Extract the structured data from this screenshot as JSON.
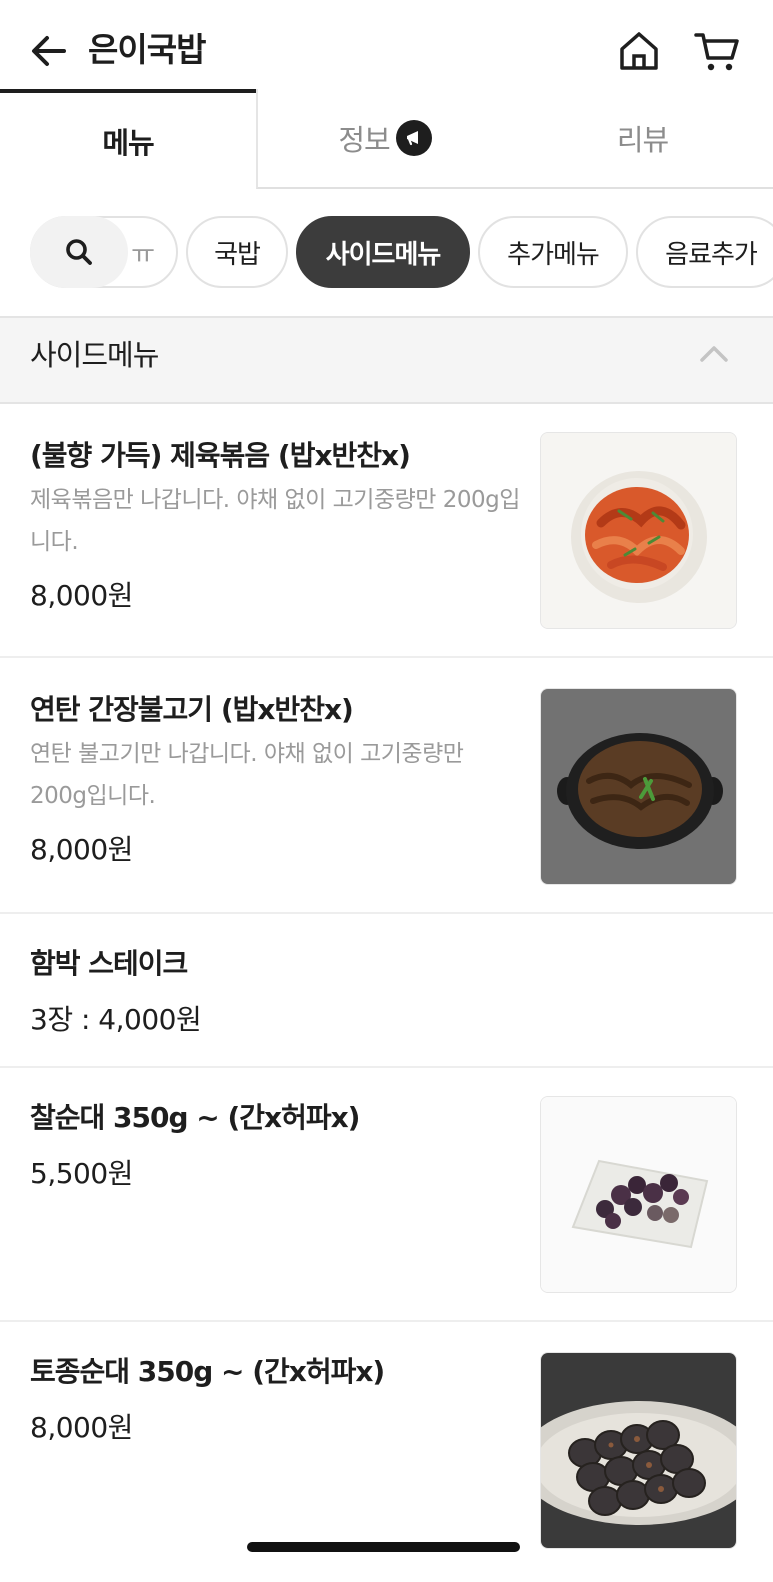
{
  "header": {
    "title": "은이국밥",
    "icons": {
      "back": "arrow-left-icon",
      "home": "home-icon",
      "cart": "cart-icon"
    }
  },
  "tabs": [
    {
      "label": "메뉴",
      "active": true
    },
    {
      "label": "정보",
      "active": false,
      "badge_icon": "megaphone-icon"
    },
    {
      "label": "리뷰",
      "active": false
    }
  ],
  "categories": {
    "search_icon": "search-icon",
    "partial_label": "ㅠ",
    "items": [
      {
        "label": "국밥",
        "active": false
      },
      {
        "label": "사이드메뉴",
        "active": true
      },
      {
        "label": "추가메뉴",
        "active": false
      },
      {
        "label": "음료추가",
        "active": false
      }
    ]
  },
  "section": {
    "title": "사이드메뉴",
    "collapse_icon": "chevron-up-icon"
  },
  "items": [
    {
      "name": "(불향 가득) 제육볶음 (밥x반찬x)",
      "desc": "제육볶음만 나갑니다. 야채 없이 고기중량만 200g입니다.",
      "price": "8,000원",
      "image": "jeyuk-bokkeum-photo"
    },
    {
      "name": "연탄 간장불고기  (밥x반찬x)",
      "desc": "연탄 불고기만 나갑니다. 야채 없이 고기중량만 200g입니다.",
      "price": "8,000원",
      "image": "bulgogi-photo"
    },
    {
      "name": "함박 스테이크",
      "price": "3장 : 4,000원"
    },
    {
      "name": "찰순대 350g ~ (간x허파x)",
      "price": "5,500원",
      "image": "chal-sundae-photo"
    },
    {
      "name": "토종순대 350g ~ (간x허파x)",
      "price": "8,000원",
      "image": "tojong-sundae-photo"
    }
  ],
  "colors": {
    "text_primary": "#1e1e1e",
    "text_secondary": "#9a9a9a",
    "chip_active_bg": "#3c3c3c",
    "section_bg": "#f5f5f5"
  }
}
